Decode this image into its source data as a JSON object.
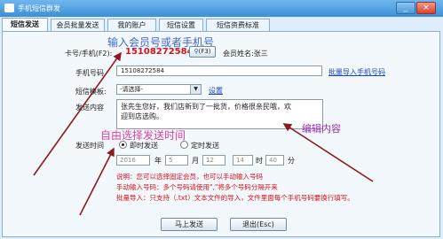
{
  "window": {
    "title": "手机短信群发",
    "minimize": "_",
    "close": "×"
  },
  "tabs": [
    {
      "label": "短信发送",
      "active": true
    },
    {
      "label": "会员批量发送"
    },
    {
      "label": "我的账户"
    },
    {
      "label": "短信设置"
    },
    {
      "label": "短信资费标准"
    }
  ],
  "annotations": {
    "member_input": "输入会员号或者手机号",
    "edit_content": "编辑内容",
    "choose_time": "自由选择发送时间"
  },
  "card": {
    "label": "卡号/手机(F2):",
    "value": "15108272584",
    "search_label": "(F3)",
    "member_name": "会员姓名:张三"
  },
  "phone": {
    "label": "手机号码",
    "value": "15108272584",
    "import_link": "批量导入手机号码"
  },
  "template": {
    "label": "短信模板:",
    "selected": "-请选择-",
    "settings_link": "设置"
  },
  "content": {
    "label": "发送内容",
    "text": "张先生您好，我们店新到了一批货，价格很亲民哦，欢\n迎到店选购。"
  },
  "send_time": {
    "label": "发送时间",
    "immediate": "即时发送",
    "scheduled": "定时发送",
    "year": "2016",
    "year_unit": "年",
    "month": "5",
    "month_unit": "月",
    "day": "12",
    "hour": "14",
    "hour_unit": "时",
    "minute": "40",
    "minute_unit": "分"
  },
  "notes": [
    "说明：您可以选择固定会员，也可以手动输入号码",
    "手动输入号码：多个号码请使用\",\"将多个号码分隔开来",
    "批量导入：只支持（.txt）文本文件的导入，文件里面每个手机号码要换行填写。"
  ],
  "buttons": {
    "send": "马上发送",
    "exit": "退出(Esc)"
  },
  "colors": {
    "annotation_blue": "#3c68d8",
    "annotation_pink": "#e23fa7",
    "card_red": "#d8121a",
    "arrow": "#8b1a1a"
  }
}
